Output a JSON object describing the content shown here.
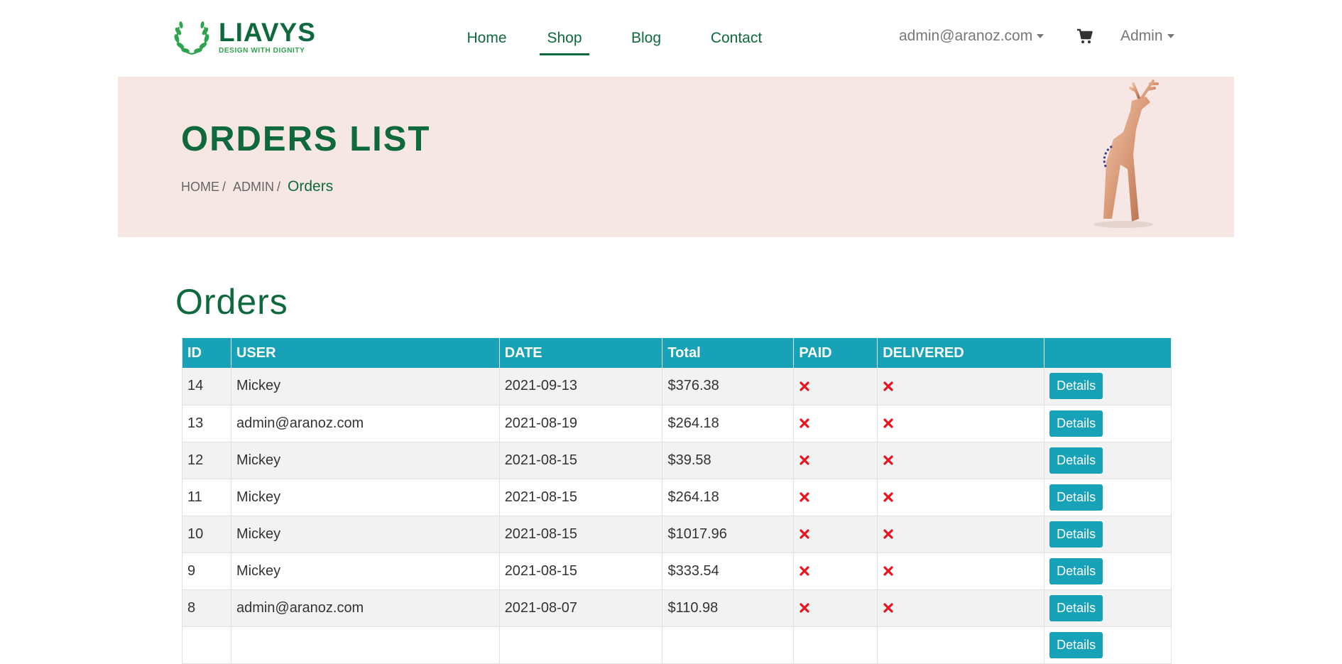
{
  "header": {
    "logo": {
      "name": "LIAVYS",
      "tagline": "DESIGN WITH DIGNITY"
    },
    "nav": [
      {
        "label": "Home"
      },
      {
        "label": "Shop"
      },
      {
        "label": "Blog"
      },
      {
        "label": "Contact"
      }
    ],
    "user_menu": "admin@aranoz.com",
    "admin_menu": "Admin",
    "cart_icon": "shopping-cart-icon",
    "colors": {
      "brand": "#0e6a3d",
      "accent": "#17a2b8",
      "banner_bg": "#f6e7e4"
    }
  },
  "banner": {
    "title": "ORDERS LIST",
    "breadcrumb": {
      "home": "HOME",
      "admin": "ADMIN",
      "current": "Orders"
    }
  },
  "main": {
    "heading": "Orders",
    "table": {
      "columns": [
        "ID",
        "USER",
        "DATE",
        "Total",
        "PAID",
        "DELIVERED",
        ""
      ],
      "button_label": "Details",
      "status_icon": "red-x-icon",
      "rows": [
        {
          "id": "14",
          "user": "Mickey",
          "date": "2021-09-13",
          "total": "$376.38"
        },
        {
          "id": "13",
          "user": "admin@aranoz.com",
          "date": "2021-08-19",
          "total": "$264.18"
        },
        {
          "id": "12",
          "user": "Mickey",
          "date": "2021-08-15",
          "total": "$39.58"
        },
        {
          "id": "11",
          "user": "Mickey",
          "date": "2021-08-15",
          "total": "$264.18"
        },
        {
          "id": "10",
          "user": "Mickey",
          "date": "2021-08-15",
          "total": "$1017.96"
        },
        {
          "id": "9",
          "user": "Mickey",
          "date": "2021-08-15",
          "total": "$333.54"
        },
        {
          "id": "8",
          "user": "admin@aranoz.com",
          "date": "2021-08-07",
          "total": "$110.98"
        },
        {
          "id": "",
          "user": "",
          "date": "",
          "total": ""
        }
      ]
    }
  }
}
